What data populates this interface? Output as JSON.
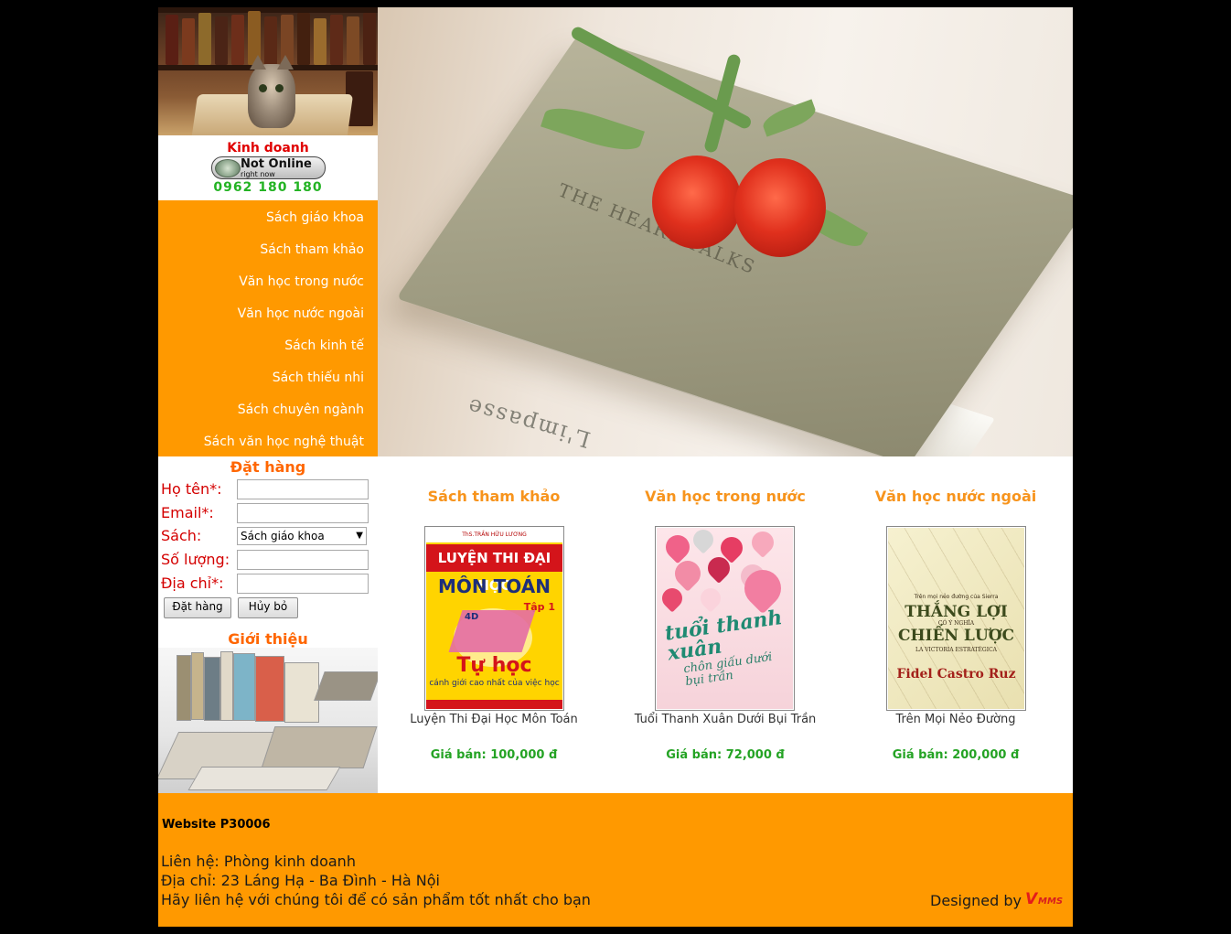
{
  "colors": {
    "accent_orange": "#ff9900",
    "title_orange": "#f7941d",
    "price_green": "#24a324",
    "label_red": "#d40000"
  },
  "contact": {
    "title": "Kinh doanh",
    "status_main": "Not Online",
    "status_sub": "right now",
    "phone": "0962 180 180"
  },
  "menu": {
    "items": [
      {
        "label": "Sách giáo khoa"
      },
      {
        "label": "Sách tham khảo"
      },
      {
        "label": "Văn học trong nước"
      },
      {
        "label": "Văn học nước ngoài"
      },
      {
        "label": "Sách kinh tế"
      },
      {
        "label": "Sách thiếu nhi"
      },
      {
        "label": "Sách chuyên ngành"
      },
      {
        "label": "Sách văn học nghệ thuật"
      }
    ]
  },
  "order": {
    "title": "Đặt hàng",
    "name_label": "Họ tên*:",
    "email_label": "Email*:",
    "book_label": "Sách:",
    "book_selected": "Sách giáo khoa",
    "qty_label": "Số lượng:",
    "address_label": "Địa chỉ*:",
    "submit": "Đặt hàng",
    "cancel": "Hủy bỏ"
  },
  "intro": {
    "title": "Giới thiệu"
  },
  "hero": {
    "spine_text": "THE HEART TALKS",
    "spine_text2": "L'impasse"
  },
  "products": [
    {
      "category": "Sách tham khảo",
      "name": "Luyện Thi Đại Học Môn Toán",
      "price": "Giá bán: 100,000 đ",
      "cover": {
        "author": "ThS.TRẦN HỮU LƯƠNG",
        "line1": "LUYỆN THI ĐẠI HỌC",
        "line2": "MÔN TOÁN",
        "tap": "Tập 1",
        "badge": "4D",
        "line3": "Tự học",
        "line4": "cánh giới cao nhất của việc học"
      }
    },
    {
      "category": "Văn học trong nước",
      "name": "Tuổi Thanh Xuân Dưới Bụi Trần",
      "price": "Giá bán: 72,000 đ",
      "cover": {
        "line1": "tuổi thanh xuân",
        "line2": "chôn giấu dưới bụi trần"
      }
    },
    {
      "category": "Văn học nước ngoài",
      "name": "Trên Mọi Nẻo Đường",
      "price": "Giá bán: 200,000 đ",
      "cover": {
        "top": "Trên mọi nẻo đường của Sierra",
        "line1": "THẮNG LỢI",
        "mid": "CÓ Ý NGHĨA",
        "line2": "CHIẾN LƯỢC",
        "es": "LA VICTORIA ESTRATÉGICA",
        "author": "Fidel Castro Ruz"
      }
    }
  ],
  "footer": {
    "site": "Website P30006",
    "contact": "Liên hệ: Phòng kinh doanh",
    "address": "Địa chỉ: 23 Láng Hạ - Ba Đình - Hà Nội",
    "slogan": "Hãy liên hệ với chúng tôi để có sản phẩm tốt nhất cho bạn",
    "designed_by": "Designed by",
    "logo_v": "V",
    "logo_mms": "MMS"
  }
}
